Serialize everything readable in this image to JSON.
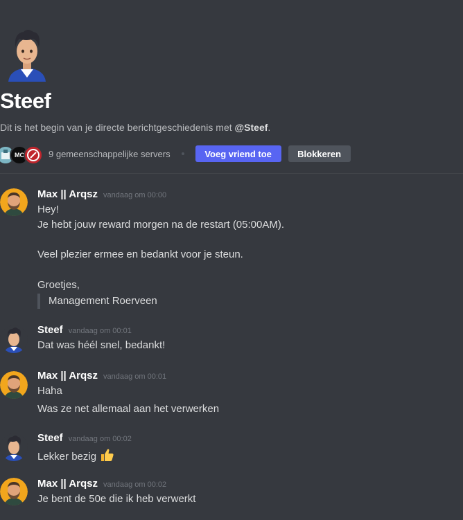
{
  "header": {
    "username": "Steef",
    "intro_prefix": "Dit is het begin van je directe berichtgeschiedenis met ",
    "intro_mention": "@Steef",
    "intro_suffix": ".",
    "server_icons": [
      {
        "name": "server-icon-1",
        "text": ""
      },
      {
        "name": "server-icon-2",
        "text": "MC"
      },
      {
        "name": "server-icon-3",
        "text": ""
      }
    ],
    "mutual_servers": "9 gemeenschappelijke servers",
    "add_friend_label": "Voeg vriend toe",
    "block_label": "Blokkeren"
  },
  "messages": [
    {
      "author": "Max || Arqsz",
      "timestamp": "vandaag om 00:00",
      "lines": [
        "Hey!",
        "Je hebt jouw reward morgen na de restart (05:00AM).",
        "",
        "Veel plezier ermee en bedankt voor je steun.",
        "",
        "Groetjes,"
      ],
      "quote": "Management Roerveen"
    },
    {
      "author": "Steef",
      "timestamp": "vandaag om 00:01",
      "lines": [
        "Dat was héél snel, bedankt!"
      ]
    },
    {
      "author": "Max || Arqsz",
      "timestamp": "vandaag om 00:01",
      "lines": [
        "Haha",
        "Was ze net allemaal aan het verwerken"
      ]
    },
    {
      "author": "Steef",
      "timestamp": "vandaag om 00:02",
      "lines": [
        "Lekker bezig"
      ],
      "emoji": "thumbs-up-icon"
    },
    {
      "author": "Max || Arqsz",
      "timestamp": "vandaag om 00:02",
      "lines": [
        "Je bent de 50e die ik heb verwerkt"
      ]
    }
  ],
  "colors": {
    "background": "#36393f",
    "accent": "#5865f2",
    "secondary_button": "#4f545c"
  }
}
